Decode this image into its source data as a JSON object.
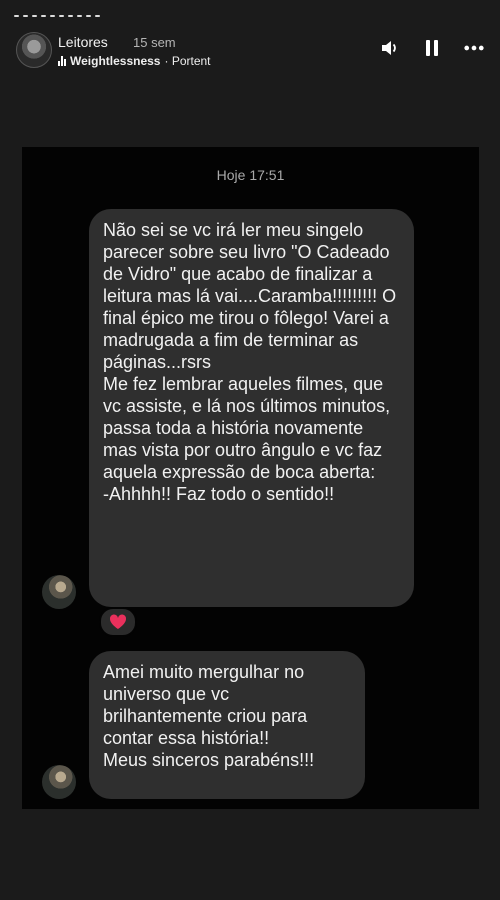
{
  "story": {
    "username": "Leitores",
    "time_ago": "15 sem",
    "music_track": "Weightlessness",
    "music_artist": " · Portent",
    "volume_icon": "volume-icon",
    "pause_icon": "pause-icon",
    "more_icon": "more-icon"
  },
  "chat": {
    "date_label": "Hoje 17:51",
    "messages": [
      {
        "text": "Não sei se vc irá ler meu singelo parecer sobre seu livro \"O Cadeado de Vidro\" que acabo de finalizar a leitura mas lá vai....Caramba!!!!!!!!! O final épico me tirou o fôlego! Varei a madrugada a fim de terminar as páginas...rsrs\nMe fez lembrar aqueles filmes, que vc assiste, e lá nos últimos minutos, passa toda a história novamente mas vista por outro ângulo e vc faz aquela expressão de boca aberta:\n-Ahhhh!! Faz todo o sentido!!",
        "reaction": "heart"
      },
      {
        "text": "Amei muito mergulhar no universo que vc brilhantemente criou para contar essa história!!\nMeus sinceros parabéns!!!"
      }
    ]
  },
  "colors": {
    "bubble": "#2f2f2f",
    "heart": "#e9305c"
  }
}
